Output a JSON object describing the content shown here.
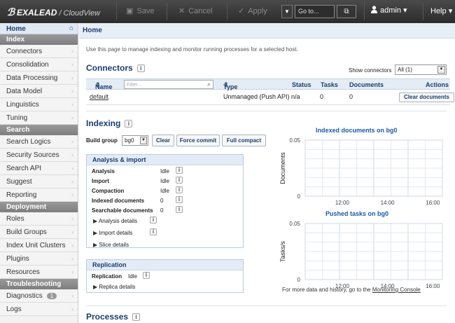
{
  "topbar": {
    "logo_brand": "EXALEAD",
    "logo_product": "CloudView",
    "save": "Save",
    "cancel": "Cancel",
    "apply": "Apply",
    "goto_placeholder": "Go to...",
    "user": "admin",
    "help": "Help"
  },
  "sidebar": {
    "home": "Home",
    "sections": [
      {
        "title": "Index",
        "items": [
          "Connectors",
          "Consolidation",
          "Data Processing",
          "Data Model",
          "Linguistics",
          "Tuning"
        ]
      },
      {
        "title": "Search",
        "items": [
          "Search Logics",
          "Security Sources",
          "Search API",
          "Suggest",
          "Reporting"
        ]
      },
      {
        "title": "Deployment",
        "items": [
          "Roles",
          "Build Groups",
          "Index Unit Clusters",
          "Plugins",
          "Resources"
        ]
      },
      {
        "title": "Troubleshooting",
        "items": [
          "Diagnostics",
          "Logs"
        ]
      }
    ],
    "diagnostics_badge": "1"
  },
  "main": {
    "breadcrumb": "Home",
    "intro": "Use this page to manage indexing and monitor running processes for a selected host.",
    "connectors": {
      "title": "Connectors",
      "show_label": "Show connectors",
      "show_value": "All (1)",
      "filter_placeholder": "Filter...",
      "headers": {
        "name": "Name",
        "type": "Type",
        "status": "Status",
        "tasks": "Tasks",
        "documents": "Documents",
        "actions": "Actions"
      },
      "rows": [
        {
          "name": "default",
          "type": "Unmanaged (Push API)",
          "status": "n/a",
          "tasks": "0",
          "documents": "0",
          "action": "Clear documents"
        }
      ]
    },
    "indexing": {
      "title": "Indexing",
      "build_group_label": "Build group",
      "build_group_value": "bg0",
      "buttons": {
        "clear": "Clear",
        "force_commit": "Force commit",
        "full_compact": "Full compact"
      },
      "analysis": {
        "title": "Analysis & import",
        "rows": [
          {
            "label": "Analysis",
            "value": "Idle"
          },
          {
            "label": "Import",
            "value": "Idle"
          },
          {
            "label": "Compaction",
            "value": "Idle"
          },
          {
            "label": "Indexed documents",
            "value": "0"
          },
          {
            "label": "Searchable documents",
            "value": "0"
          }
        ],
        "details": [
          "Analysis details",
          "Import details",
          "Slice details"
        ]
      },
      "replication": {
        "title": "Replication",
        "label": "Replication",
        "value": "Idle",
        "details": "Replica details"
      }
    },
    "monitoring_note": "For more data and history, go to the",
    "monitoring_link": "Monitoring Console",
    "processes_title": "Processes"
  },
  "chart_data": [
    {
      "type": "line",
      "title": "Indexed documents on bg0",
      "ylabel": "Documents",
      "ylim": [
        0,
        0.05
      ],
      "y_ticks": [
        "0.05",
        "0"
      ],
      "x_ticks": [
        "12:00",
        "14:00",
        "16:00"
      ],
      "series": []
    },
    {
      "type": "line",
      "title": "Pushed tasks on bg0",
      "ylabel": "Tasks/s",
      "ylim": [
        0,
        0.05
      ],
      "y_ticks": [
        "0.05",
        "0"
      ],
      "x_ticks": [
        "12:00",
        "14:00",
        "16:00"
      ],
      "series": []
    }
  ]
}
